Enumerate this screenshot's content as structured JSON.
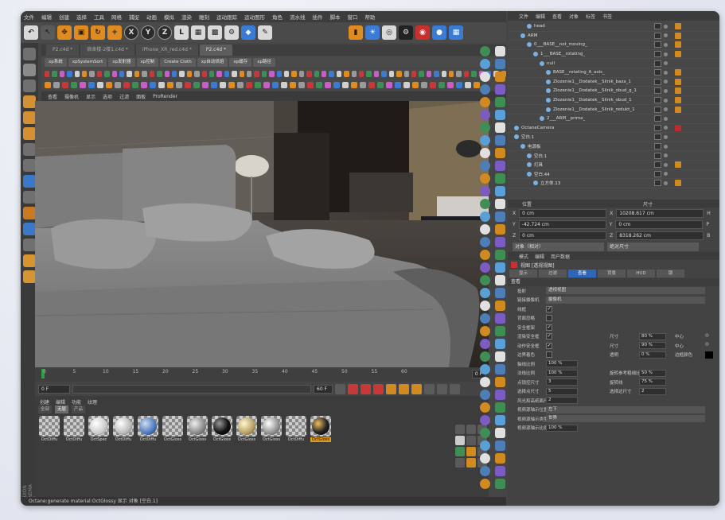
{
  "menu": [
    "文件",
    "编辑",
    "创建",
    "选择",
    "工具",
    "网格",
    "捕捉",
    "动画",
    "模拟",
    "渲染",
    "雕刻",
    "运动跟踪",
    "运动图形",
    "角色",
    "流水线",
    "插件",
    "脚本",
    "窗口",
    "帮助"
  ],
  "doc_tabs": [
    "P2.c4d *",
    "宿舍楼-2楼1.c4d *",
    "iPhone_XR_red.c4d *",
    "P2.c4d *"
  ],
  "plugin_buttons": [
    "xp系统",
    "xpSystemSort",
    "xp发射器",
    "xp控制",
    "Create Cloth",
    "xp自动烘焙",
    "xp缓存",
    "xp路径"
  ],
  "viewport_menu": [
    "查看",
    "摄像机",
    "显示",
    "选项",
    "过滤",
    "面板",
    "ProRender"
  ],
  "timeline_ticks": [
    "0",
    "5",
    "10",
    "15",
    "20",
    "25",
    "30",
    "35",
    "40",
    "45",
    "50",
    "55",
    "60"
  ],
  "timeline_end": "0 F",
  "transport": {
    "start": "0 F",
    "current": "0 F",
    "end": "60 F"
  },
  "materials_panel": {
    "menu": [
      "创建",
      "编辑",
      "功能",
      "纹理"
    ],
    "filters": [
      "全部",
      "无层",
      "产品"
    ],
    "active_filter": "无层",
    "items": [
      {
        "name": "OctDiffu",
        "kind": "checker"
      },
      {
        "name": "OctDiffu",
        "kind": "checker"
      },
      {
        "name": "OctSpec",
        "kind": "spec"
      },
      {
        "name": "OctDiffu",
        "kind": "white"
      },
      {
        "name": "OctDiffu",
        "kind": "blue"
      },
      {
        "name": "OctGloss",
        "kind": "checker"
      },
      {
        "name": "OctGloss",
        "kind": "gray"
      },
      {
        "name": "OctGloss",
        "kind": "black"
      },
      {
        "name": "OctGloss",
        "kind": "gold"
      },
      {
        "name": "OctGloss",
        "kind": "silver"
      },
      {
        "name": "OctDiffu",
        "kind": "checker"
      },
      {
        "name": "OctGloss",
        "kind": "dark",
        "selected": true
      }
    ]
  },
  "status_text": "Octane:generate material:OctGlossy     显示 对象 [空白.1]",
  "side_label": "MAXON CINEMA 4D",
  "right_tabs": [
    "文件",
    "编辑",
    "查看",
    "对象",
    "标签",
    "书签"
  ],
  "tree": [
    {
      "name": "head",
      "indent": 2,
      "tag": "orange"
    },
    {
      "name": "ARM",
      "indent": 1,
      "tag": "orange"
    },
    {
      "name": "0___BASE__not_moving_",
      "indent": 2,
      "tag": "orange"
    },
    {
      "name": "1___BASE__rotating_",
      "indent": 3,
      "tag": "orange"
    },
    {
      "name": "null",
      "indent": 4,
      "tag": ""
    },
    {
      "name": "BASE__rotating_A_axis_",
      "indent": 5,
      "tag": "orange"
    },
    {
      "name": "Zlozenie1__Dodatek__Silnik_baza_1",
      "indent": 5,
      "tag": "orange"
    },
    {
      "name": "Zlozenie1__Dodatek__Silnik_obud_g_1",
      "indent": 5,
      "tag": "orange"
    },
    {
      "name": "Zlozenie1__Dodatek__Silnik_obud_1",
      "indent": 5,
      "tag": "orange"
    },
    {
      "name": "Zlozenie1__Dodatek__Silnik_redukt_1",
      "indent": 5,
      "tag": "orange"
    },
    {
      "name": "2___ARM__prime_",
      "indent": 4,
      "tag": ""
    },
    {
      "name": "OctaneCamera",
      "indent": 0,
      "tag": "red"
    },
    {
      "name": "空白.1",
      "indent": 0,
      "tag": ""
    },
    {
      "name": "电源板",
      "indent": 1,
      "tag": ""
    },
    {
      "name": "空白.1",
      "indent": 2,
      "tag": ""
    },
    {
      "name": "灯具",
      "indent": 2,
      "tag": "orange"
    },
    {
      "name": "空白.44",
      "indent": 2,
      "tag": ""
    },
    {
      "name": "立方体.13",
      "indent": 3,
      "tag": "orange"
    }
  ],
  "coords": {
    "head_pos": "位置",
    "head_size": "尺寸",
    "rows": [
      {
        "axis": "X",
        "pos": "0 cm",
        "size": "10208.617 cm",
        "rot": "H"
      },
      {
        "axis": "Y",
        "pos": "-42.724 cm",
        "size": "0 cm",
        "rot": "P"
      },
      {
        "axis": "Z",
        "pos": "0 cm",
        "size": "8318.262 cm",
        "rot": "B"
      }
    ],
    "mode1": "对象（相对）",
    "mode2": "绝对尺寸"
  },
  "attr": {
    "menu": [
      "模式",
      "编辑",
      "用户数据"
    ],
    "title": "视图 [透视视图]",
    "tabs": [
      "显示",
      "过滤",
      "查看",
      "背景",
      "HUD",
      "镜"
    ],
    "active_tab": "查看",
    "section": "查看",
    "rows": [
      {
        "label": "投射",
        "value": "透视视图",
        "wide": true
      },
      {
        "label": "链接摄像机",
        "value": "摄像机",
        "wide": true
      },
      {
        "label": "线框",
        "check": "✓"
      },
      {
        "label": "背面忽略",
        "check": ""
      },
      {
        "label": "安全框架",
        "check": "✓"
      },
      {
        "label": "渲染安全框",
        "check": "✓",
        "r": "尺寸",
        "rv": "80 %",
        "r2": "中心",
        "r2v": "◎"
      },
      {
        "label": "动作安全框",
        "check": "✓",
        "r": "尺寸",
        "rv": "90 %",
        "r2": "中心",
        "r2v": "◎"
      },
      {
        "label": "边界着色",
        "check": "",
        "r": "透明",
        "rv": "0 %",
        "r2": "边框颜色",
        "r2v": ""
      },
      {
        "label": "轴线比例",
        "value": "100 %"
      },
      {
        "label": "法线比例",
        "value": "100 %",
        "r": "旋转参考粗细比例",
        "rv": "50 %"
      },
      {
        "label": "点锁控尺寸",
        "value": "3",
        "r": "旋转线",
        "rv": "75 %"
      },
      {
        "label": "选择点尺寸",
        "value": "5",
        "r": "选择边尺寸",
        "rv": "2"
      },
      {
        "label": "风光和高纸面尺寸",
        "value": "2"
      },
      {
        "label": "视频源轴示位置",
        "value": "左下",
        "wide": true
      },
      {
        "label": "视频源轴示类型",
        "value": "世界",
        "wide": true
      },
      {
        "label": "视频源轴示比例",
        "value": "100 %"
      }
    ]
  }
}
